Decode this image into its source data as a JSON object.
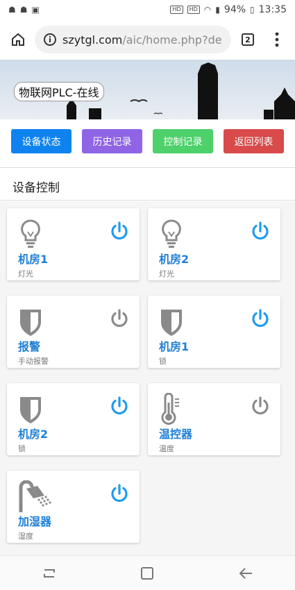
{
  "status_bar": {
    "time": "13:35",
    "battery": "94%",
    "hd1": "HD",
    "hd2": "HD"
  },
  "browser": {
    "url_host": "szytgl.com",
    "url_path": "/aic/home.php?de",
    "tab_count": "2"
  },
  "banner": {
    "title": "物联网PLC-在线"
  },
  "nav_buttons": [
    {
      "label": "设备状态",
      "color": "#0E83F0"
    },
    {
      "label": "历史记录",
      "color": "#8F65E6"
    },
    {
      "label": "控制记录",
      "color": "#4ED06A"
    },
    {
      "label": "返回列表",
      "color": "#D94A4A"
    }
  ],
  "section": {
    "title": "设备控制"
  },
  "colors": {
    "power_on": "#1E9BF0",
    "power_off": "#8A8A8A",
    "name": "#1E7FD6",
    "icon": "#8A8A8A"
  },
  "devices": [
    {
      "name": "机房1",
      "desc": "灯光",
      "icon": "bulb-icon",
      "state": "on"
    },
    {
      "name": "机房2",
      "desc": "灯光",
      "icon": "bulb-icon",
      "state": "on"
    },
    {
      "name": "报警",
      "desc": "手动报警",
      "icon": "shield-icon",
      "state": "off"
    },
    {
      "name": "机房1",
      "desc": "锁",
      "icon": "shield-icon",
      "state": "on"
    },
    {
      "name": "机房2",
      "desc": "锁",
      "icon": "shield-icon",
      "state": "on"
    },
    {
      "name": "温控器",
      "desc": "温度",
      "icon": "thermometer-icon",
      "state": "off"
    },
    {
      "name": "加湿器",
      "desc": "湿度",
      "icon": "shower-icon",
      "state": "on"
    }
  ]
}
